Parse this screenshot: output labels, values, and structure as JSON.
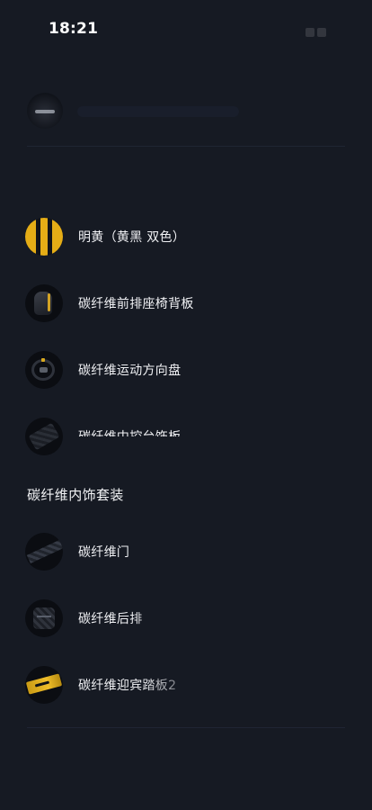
{
  "status_bar": {
    "time": "18:21"
  },
  "interior_options": {
    "items": [
      {
        "label": "明黄（黄黑 双色）",
        "icon": "two-tone-yellow-black-swatch"
      },
      {
        "label": "碳纤维前排座椅背板",
        "icon": "carbon-seat-back-panel"
      },
      {
        "label": "碳纤维运动方向盘",
        "icon": "carbon-steering-wheel"
      },
      {
        "label": "碳纤维中控台饰板",
        "icon": "carbon-center-console-trim"
      }
    ]
  },
  "carbon_package": {
    "title": "碳纤维内饰套装",
    "items": [
      {
        "label": "碳纤维门",
        "icon": "carbon-door-trim"
      },
      {
        "label": "碳纤维后排",
        "icon": "carbon-rear-seat"
      },
      {
        "label": "碳纤维迎宾踏板2",
        "icon": "carbon-door-sill-plate"
      }
    ]
  },
  "colors": {
    "background": "#161a23",
    "accent_yellow": "#e5ad16",
    "text": "#f1f2f5"
  }
}
